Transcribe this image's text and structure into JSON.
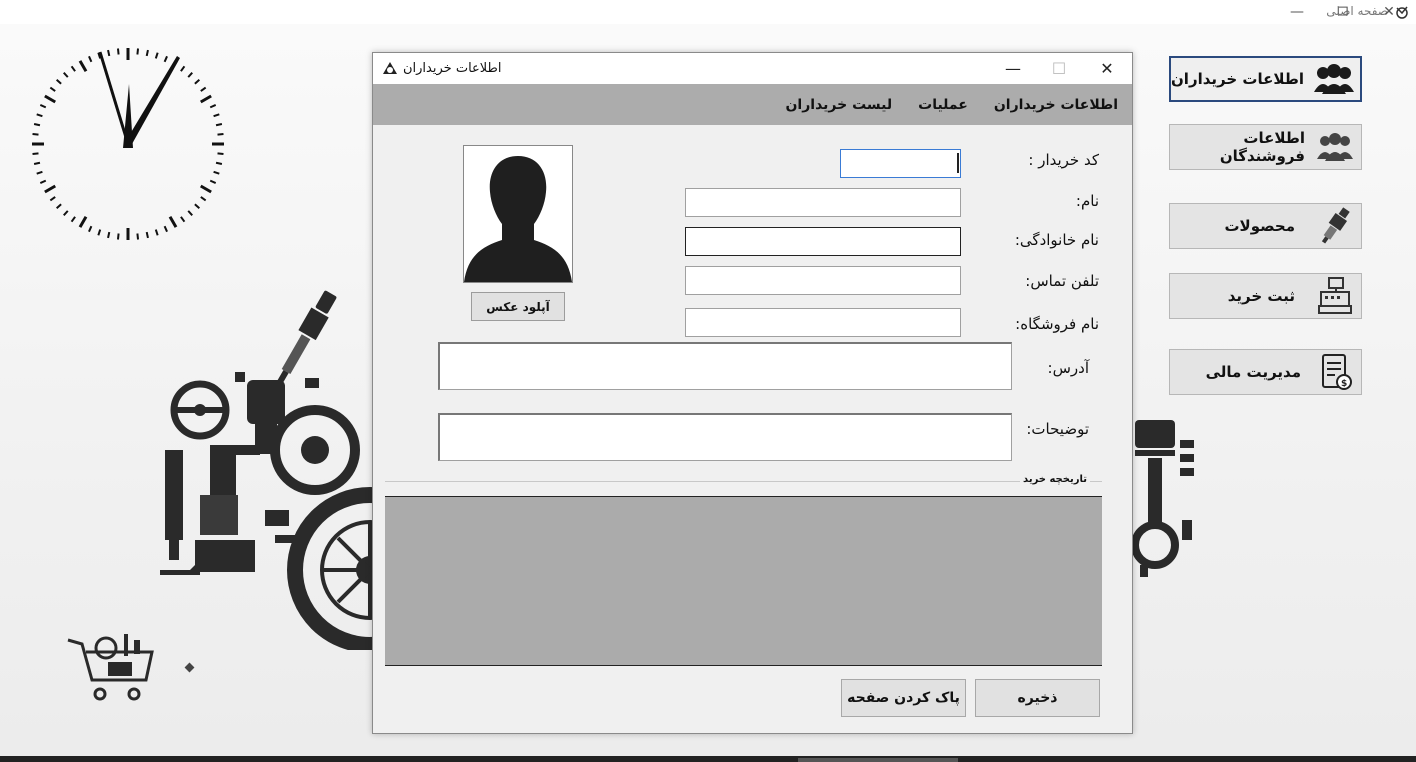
{
  "main_window": {
    "title": "صفحه اصلی",
    "controls": {
      "minimize": "—",
      "restore": "❐",
      "close": "✕"
    }
  },
  "nav": [
    {
      "id": "buyers",
      "label": "اطلاعات خریداران",
      "icon": "users-icon",
      "active": true
    },
    {
      "id": "sellers",
      "label": "اطلاعات فروشندگان",
      "icon": "group-icon",
      "active": false
    },
    {
      "id": "products",
      "label": "محصولات",
      "icon": "spark-plug-icon",
      "active": false
    },
    {
      "id": "purchase",
      "label": "ثبت خرید",
      "icon": "cash-register-icon",
      "active": false
    },
    {
      "id": "finance",
      "label": "مدیریت مالی",
      "icon": "invoice-icon",
      "active": false
    }
  ],
  "child_window": {
    "title": "اطلاعات خریداران",
    "controls": {
      "minimize": "—",
      "maximize": "☐",
      "close": "✕"
    },
    "menu": [
      "اطلاعات خریداران",
      "عملیات",
      "لیست خریداران"
    ],
    "form": {
      "buyer_code_label": "کد خریدار :",
      "buyer_code_value": "",
      "first_name_label": "نام:",
      "first_name_value": "",
      "last_name_label": "نام خانوادگی:",
      "last_name_value": "",
      "phone_label": "تلفن تماس:",
      "phone_value": "",
      "store_name_label": "نام فروشگاه:",
      "store_name_value": "",
      "address_label": "آدرس:",
      "address_value": "",
      "notes_label": "توضیحات:",
      "notes_value": ""
    },
    "upload_photo_label": "آپلود عکس",
    "history_caption": "تاریخچه خرید",
    "save_label": "ذخیره",
    "clear_label": "پاک کردن صفحه"
  },
  "colors": {
    "menubar": "#acacac",
    "grid": "#ababab",
    "active_border": "#2b4a7e",
    "focus_border": "#3a7bd5"
  }
}
